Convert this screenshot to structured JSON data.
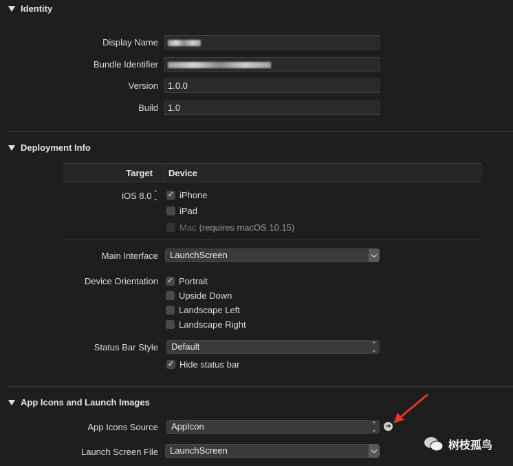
{
  "identity": {
    "header": "Identity",
    "display_name_label": "Display Name",
    "bundle_identifier_label": "Bundle Identifier",
    "version_label": "Version",
    "version_value": "1.0.0",
    "build_label": "Build",
    "build_value": "1.0"
  },
  "deployment": {
    "header": "Deployment Info",
    "target_header": "Target",
    "device_header": "Device",
    "ios_version": "iOS 8.0",
    "devices": {
      "iphone": "iPhone",
      "ipad": "iPad",
      "mac": "Mac",
      "mac_note": "(requires macOS 10.15)"
    },
    "main_interface_label": "Main Interface",
    "main_interface_value": "LaunchScreen",
    "device_orientation_label": "Device Orientation",
    "orientations": {
      "portrait": "Portrait",
      "upside_down": "Upside Down",
      "landscape_left": "Landscape Left",
      "landscape_right": "Landscape Right"
    },
    "status_bar_style_label": "Status Bar Style",
    "status_bar_style_value": "Default",
    "hide_status_bar": "Hide status bar"
  },
  "app_icons": {
    "header": "App Icons and Launch Images",
    "app_icons_source_label": "App Icons Source",
    "app_icons_source_value": "AppIcon",
    "launch_screen_file_label": "Launch Screen File",
    "launch_screen_file_value": "LaunchScreen"
  },
  "watermark": "树枝孤鸟",
  "colors": {
    "background": "#1e1e1e",
    "annotation_arrow": "#e8362a"
  }
}
